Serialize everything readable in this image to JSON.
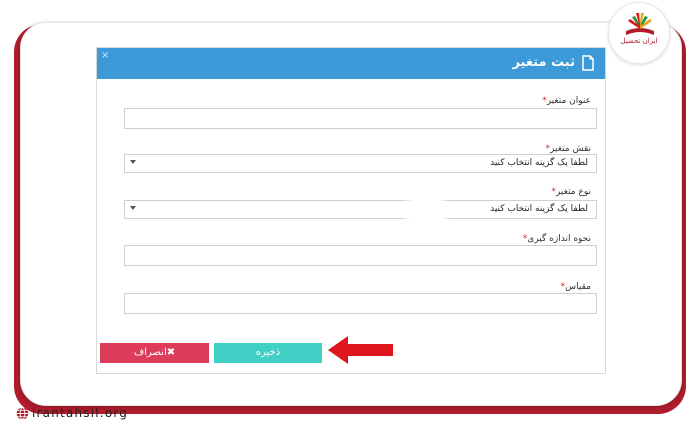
{
  "modal": {
    "title": "ثبت متغیر",
    "close": "×"
  },
  "fields": {
    "variable_title": {
      "label": "عنوان متغیر",
      "required": "*",
      "value": ""
    },
    "variable_role": {
      "label": "نقش متغیر",
      "required": "*",
      "selected": "لطفا یک گزینه انتخاب کنید"
    },
    "variable_type": {
      "label": "نوع متغیر",
      "required": "*",
      "selected": "لطفا یک گزینه انتخاب کنید"
    },
    "measurement_method": {
      "label": "نحوه اندازه گیری",
      "required": "*",
      "value": ""
    },
    "scale": {
      "label": "مقیاس",
      "required": "*",
      "value": ""
    }
  },
  "buttons": {
    "save": "ذخیره",
    "cancel": "انصراف",
    "cancel_icon": "✖"
  },
  "branding": {
    "logo_text": "ایران تحصیل",
    "site": "irantahsil.org"
  },
  "colors": {
    "header": "#3d9ad9",
    "save": "#41d0c6",
    "cancel": "#dd3d5b",
    "arrow": "#e0161f",
    "frame": "#b01c2c"
  },
  "icons": {
    "title": "document-icon",
    "close": "close-icon",
    "arrow": "left-arrow-icon",
    "site": "globe-icon"
  }
}
